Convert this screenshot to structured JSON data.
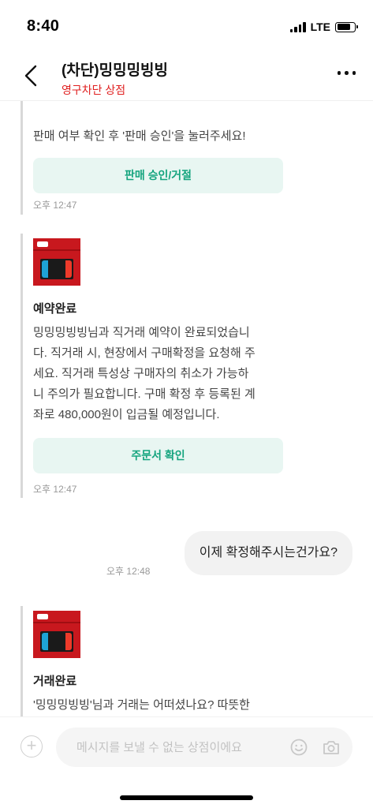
{
  "status_bar": {
    "time": "8:40",
    "network": "LTE"
  },
  "header": {
    "title": "(차단)밍밍밍빙빙",
    "subtitle": "영구차단 상점",
    "back_icon": "chevron-left-icon",
    "more_icon": "more-horizontal-icon"
  },
  "messages": [
    {
      "type": "system_card",
      "text": "판매 여부 확인 후 '판매 승인'을 눌러주세요!",
      "button_label": "판매 승인/거절",
      "time": "오후 12:47"
    },
    {
      "type": "system_card",
      "image": "nintendo-switch-box-image",
      "title": "예약완료",
      "body_lines": [
        "밍밍밍빙빙님과 직거래 예약이 완료되었습니",
        "다. 직거래 시, 현장에서 구매확정을 요청해 주",
        "세요. 직거래 특성상 구매자의 취소가 가능하",
        "니 주의가 필요합니다. 구매 확정 후 등록된 계",
        "좌로 480,000원이 입금될 예정입니다."
      ],
      "button_label": "주문서 확인",
      "time": "오후 12:47"
    },
    {
      "type": "outgoing",
      "text": "이제 확정해주시는건가요?",
      "time": "오후 12:48"
    },
    {
      "type": "system_card",
      "image": "nintendo-switch-box-image",
      "title": "거래완료",
      "body_lines": [
        "'밍밍밍빙빙'님과 거래는 어떠셨나요? 따뜻한"
      ]
    }
  ],
  "input_bar": {
    "placeholder": "메시지를 보낼 수 없는 상점이에요",
    "plus_icon": "plus-circle-icon",
    "emoji_icon": "smile-icon",
    "camera_icon": "camera-icon"
  },
  "colors": {
    "accent_green": "#14a47e",
    "button_bg": "#e8f6f2",
    "blocked_red": "#e02020",
    "product_red": "#c8181e"
  }
}
